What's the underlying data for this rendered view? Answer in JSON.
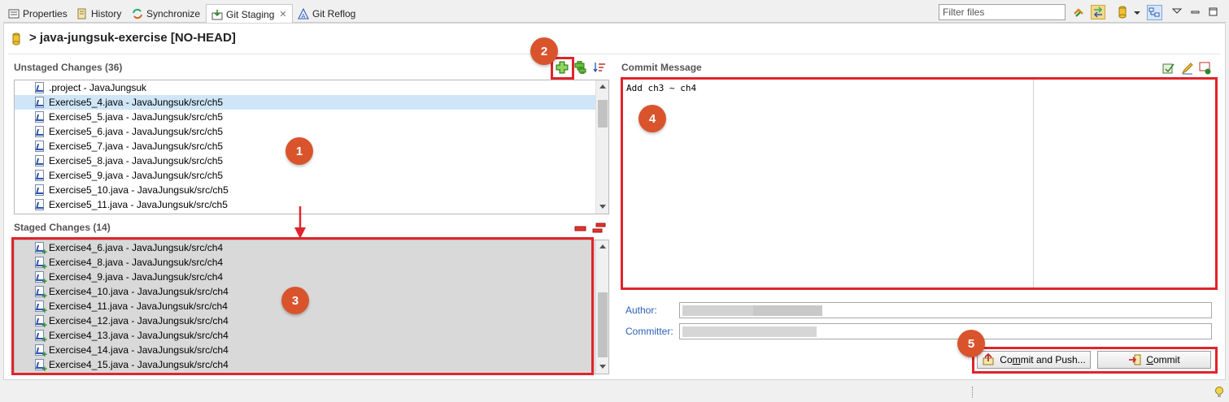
{
  "tabs": [
    {
      "label": "Properties",
      "icon": "properties-icon"
    },
    {
      "label": "History",
      "icon": "history-icon"
    },
    {
      "label": "Synchronize",
      "icon": "synchronize-icon"
    },
    {
      "label": "Git Staging",
      "icon": "git-staging-icon",
      "active": true
    },
    {
      "label": "Git Reflog",
      "icon": "git-reflog-icon"
    }
  ],
  "filter": {
    "placeholder": "Filter files"
  },
  "repo": {
    "title": "> java-jungsuk-exercise [NO-HEAD]"
  },
  "unstaged": {
    "header": "Unstaged Changes (36)",
    "items": [
      ".project - JavaJungsuk",
      "Exercise5_4.java - JavaJungsuk/src/ch5",
      "Exercise5_5.java - JavaJungsuk/src/ch5",
      "Exercise5_6.java - JavaJungsuk/src/ch5",
      "Exercise5_7.java - JavaJungsuk/src/ch5",
      "Exercise5_8.java - JavaJungsuk/src/ch5",
      "Exercise5_9.java - JavaJungsuk/src/ch5",
      "Exercise5_10.java - JavaJungsuk/src/ch5",
      "Exercise5_11.java - JavaJungsuk/src/ch5"
    ]
  },
  "staged": {
    "header": "Staged Changes (14)",
    "items": [
      "Exercise4_6.java - JavaJungsuk/src/ch4",
      "Exercise4_8.java - JavaJungsuk/src/ch4",
      "Exercise4_9.java - JavaJungsuk/src/ch4",
      "Exercise4_10.java - JavaJungsuk/src/ch4",
      "Exercise4_11.java - JavaJungsuk/src/ch4",
      "Exercise4_12.java - JavaJungsuk/src/ch4",
      "Exercise4_13.java - JavaJungsuk/src/ch4",
      "Exercise4_14.java - JavaJungsuk/src/ch4",
      "Exercise4_15.java - JavaJungsuk/src/ch4"
    ]
  },
  "commit": {
    "header": "Commit Message",
    "message": "Add ch3 ~ ch4",
    "author_label": "Author:",
    "committer_label": "Committer:",
    "commit_push_prefix": "Co",
    "commit_push_mnemonic": "m",
    "commit_push_suffix": "mit and Push...",
    "commit_mnemonic": "C",
    "commit_suffix": "ommit"
  },
  "annotations": [
    "1",
    "2",
    "3",
    "4",
    "5"
  ],
  "colors": {
    "highlight": "#e0242c",
    "badge": "#d9542c",
    "selection": "#cfe6f8",
    "staged_bg": "#d9d9d9"
  }
}
